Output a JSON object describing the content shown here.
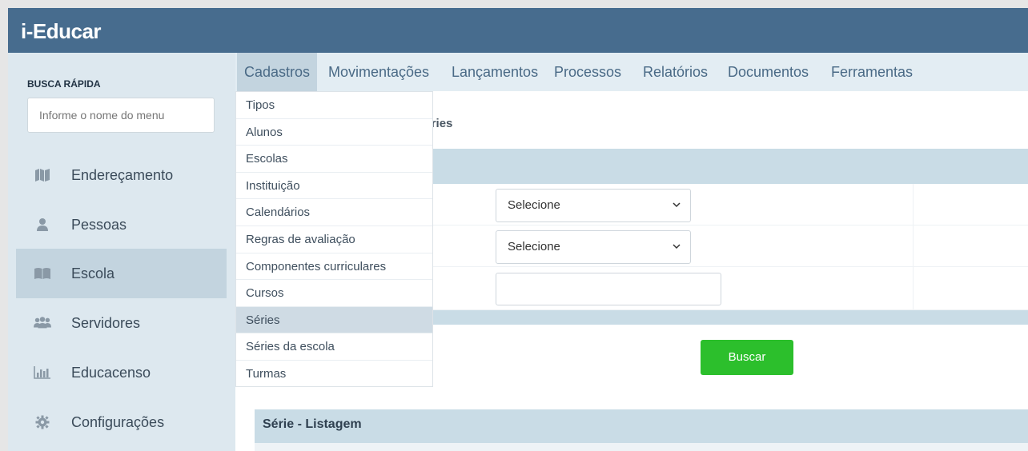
{
  "app": {
    "title": "i-Educar"
  },
  "sidebar": {
    "search_label": "BUSCA RÁPIDA",
    "search_placeholder": "Informe o nome do menu",
    "items": [
      {
        "label": "Endereçamento",
        "icon": "map-icon"
      },
      {
        "label": "Pessoas",
        "icon": "person-icon"
      },
      {
        "label": "Escola",
        "icon": "book-icon",
        "active": true
      },
      {
        "label": "Servidores",
        "icon": "group-icon"
      },
      {
        "label": "Educacenso",
        "icon": "bar-chart-icon"
      },
      {
        "label": "Configurações",
        "icon": "gear-icon"
      }
    ]
  },
  "menu": {
    "items": [
      "Cadastros",
      "Movimentações",
      "Lançamentos",
      "Processos",
      "Relatórios",
      "Documentos",
      "Ferramentas"
    ],
    "active": "Cadastros"
  },
  "dropdown": {
    "items": [
      "Tipos",
      "Alunos",
      "Escolas",
      "Instituição",
      "Calendários",
      "Regras de avaliação",
      "Componentes curriculares",
      "Cursos",
      "Séries",
      "Séries da escola",
      "Turmas"
    ],
    "active": "Séries"
  },
  "content": {
    "title_fragment": "séries",
    "select1_value": "Selecione",
    "select2_value": "Selecione",
    "buscar_label": "Buscar",
    "listagem_title": "Série - Listagem"
  },
  "colors": {
    "topbar": "#476c8e",
    "sidebar": "#dde8ef",
    "accent_green": "#2cbf2c"
  }
}
